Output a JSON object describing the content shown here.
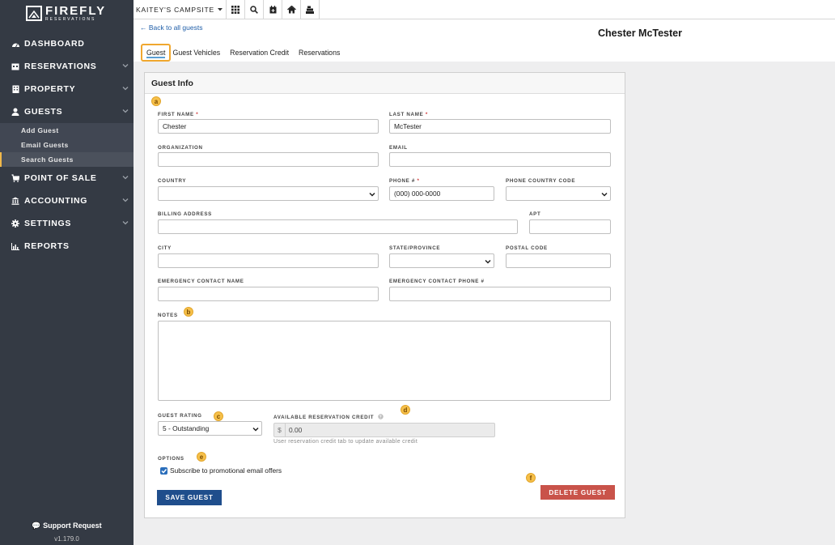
{
  "brand": {
    "name": "FIREFLY",
    "sub": "RESERVATIONS"
  },
  "sidebar": {
    "items": [
      {
        "label": "DASHBOARD",
        "icon": "dashboard-icon"
      },
      {
        "label": "RESERVATIONS",
        "icon": "calendar-icon"
      },
      {
        "label": "PROPERTY",
        "icon": "building-icon"
      },
      {
        "label": "GUESTS",
        "icon": "user-icon"
      },
      {
        "label": "POINT OF SALE",
        "icon": "cart-icon"
      },
      {
        "label": "ACCOUNTING",
        "icon": "bank-icon"
      },
      {
        "label": "SETTINGS",
        "icon": "gear-icon"
      },
      {
        "label": "REPORTS",
        "icon": "chart-icon"
      }
    ],
    "guest_sub": [
      "Add Guest",
      "Email Guests",
      "Search Guests"
    ],
    "support": "Support Request",
    "version": "v1.179.0"
  },
  "topbar": {
    "campsite": "KAITEY'S CAMPSITE"
  },
  "page": {
    "back_link": "← Back to all guests",
    "title": "Chester McTester",
    "tabs": [
      "Guest",
      "Guest Vehicles",
      "Reservation Credit",
      "Reservations"
    ]
  },
  "form": {
    "card_title": "Guest Info",
    "labels": {
      "first_name": "FIRST NAME",
      "last_name": "LAST NAME",
      "organization": "ORGANIZATION",
      "email": "EMAIL",
      "country": "COUNTRY",
      "phone": "PHONE #",
      "phone_country_code": "PHONE COUNTRY CODE",
      "billing_address": "BILLING ADDRESS",
      "apt": "APT",
      "city": "CITY",
      "state": "STATE/PROVINCE",
      "postal": "POSTAL CODE",
      "emergency_name": "EMERGENCY CONTACT NAME",
      "emergency_phone": "EMERGENCY CONTACT PHONE #",
      "notes": "NOTES",
      "guest_rating": "GUEST RATING",
      "available_credit": "AVAILABLE RESERVATION CREDIT",
      "options": "OPTIONS"
    },
    "required_mark": "*",
    "values": {
      "first_name": "Chester",
      "last_name": "McTester",
      "phone_placeholder": "(000) 000-0000",
      "guest_rating": "5 - Outstanding",
      "credit_prefix": "$",
      "credit_value": "0.00"
    },
    "credit_hint": "User reservation credit tab to update available credit",
    "subscribe_label": "Subscribe to promotional email offers",
    "save_label": "SAVE GUEST",
    "delete_label": "DELETE GUEST",
    "markers": [
      "a",
      "b",
      "c",
      "d",
      "e",
      "f"
    ]
  },
  "colors": {
    "sidebar": "#343a44",
    "accent": "#f0a72f",
    "primary": "#1f4e8c",
    "danger": "#c9534a"
  }
}
